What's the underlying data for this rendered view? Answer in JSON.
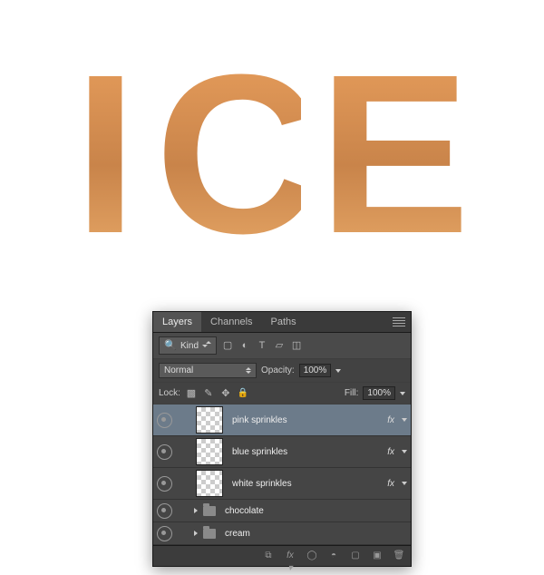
{
  "artwork": {
    "text": "ICE"
  },
  "panel": {
    "tabs": {
      "layers": "Layers",
      "channels": "Channels",
      "paths": "Paths"
    },
    "filter": {
      "kind": "Kind"
    },
    "blend": {
      "mode": "Normal",
      "opacity_label": "Opacity:",
      "opacity_value": "100%"
    },
    "lock": {
      "label": "Lock:",
      "fill_label": "Fill:",
      "fill_value": "100%"
    },
    "layers": [
      {
        "name": "pink sprinkles",
        "fx": "fx",
        "selected": true
      },
      {
        "name": "blue sprinkles",
        "fx": "fx",
        "selected": false
      },
      {
        "name": "white sprinkles",
        "fx": "fx",
        "selected": false
      }
    ],
    "groups": [
      {
        "name": "chocolate"
      },
      {
        "name": "cream"
      }
    ],
    "icons": {
      "search": "🔍",
      "image": "▢",
      "adjust": "◐",
      "type": "T",
      "shape": "▱",
      "path": "◫",
      "link": "⧉",
      "fxbtn": "fx ▾",
      "mask": "◯",
      "fill": "◓",
      "newgrp": "▢",
      "newlyr": "▣",
      "trash": "🗑"
    }
  }
}
